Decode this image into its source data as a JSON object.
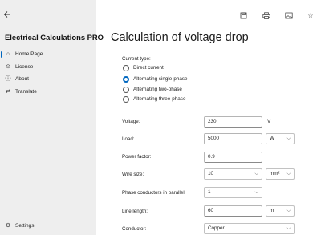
{
  "sidebar": {
    "app_title": "Electrical Calculations PRO",
    "items": [
      {
        "label": "Home Page",
        "icon": "home-icon"
      },
      {
        "label": "License",
        "icon": "license-icon"
      },
      {
        "label": "About",
        "icon": "info-icon"
      },
      {
        "label": "Translate",
        "icon": "translate-icon"
      }
    ],
    "settings_label": "Settings"
  },
  "main": {
    "title": "Calculation of voltage drop",
    "current_type": {
      "label": "Current type:",
      "options": [
        "Direct current",
        "Alternating single-phase",
        "Alternating two-phase",
        "Alternating three-phase"
      ],
      "selected": "Alternating single-phase"
    },
    "fields": {
      "voltage": {
        "label": "Voltage:",
        "value": "230",
        "unit": "V"
      },
      "load": {
        "label": "Load:",
        "value": "5000",
        "unit": "W"
      },
      "power_factor": {
        "label": "Power factor:",
        "value": "0.9"
      },
      "wire_size": {
        "label": "Wire size:",
        "value": "10",
        "unit": "mm²"
      },
      "phase_conductors": {
        "label": "Phase conductors in parallel:",
        "value": "1"
      },
      "line_length": {
        "label": "Line length:",
        "value": "60",
        "unit": "m"
      },
      "conductor": {
        "label": "Conductor:",
        "value": "Copper"
      }
    }
  },
  "colors": {
    "accent": "#0067c0",
    "sidebar_bg": "#eeeeee"
  }
}
